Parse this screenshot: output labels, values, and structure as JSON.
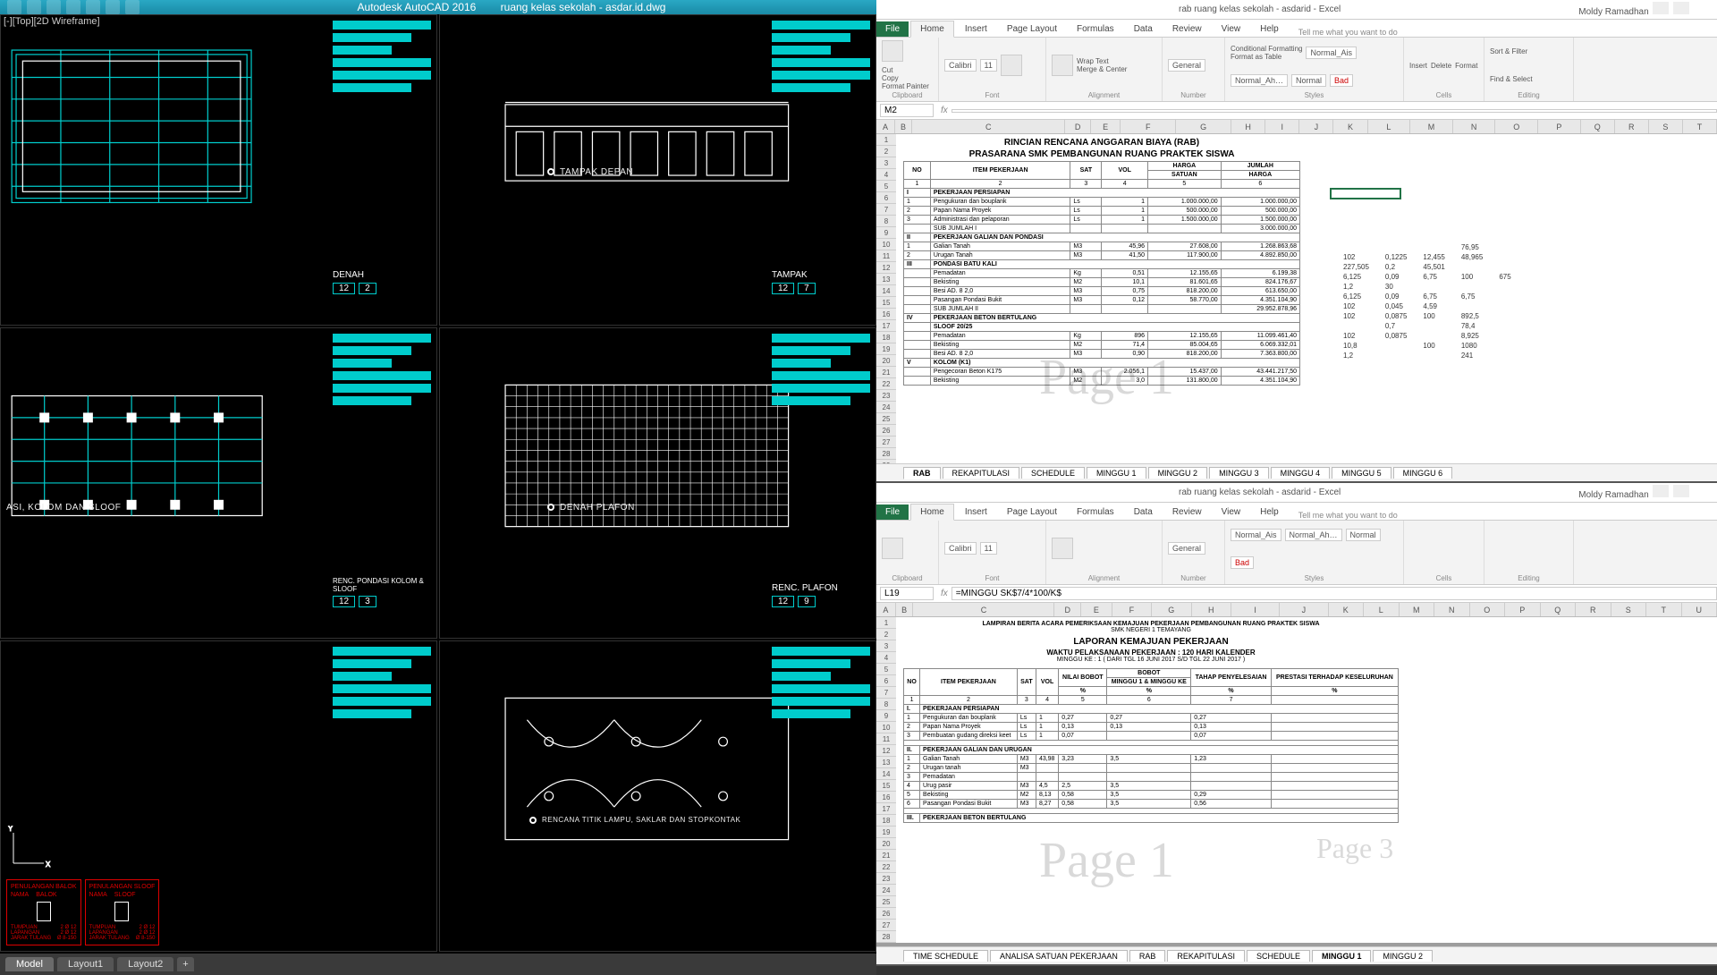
{
  "autocad": {
    "app_title": "Autodesk AutoCAD 2016",
    "file_name": "ruang kelas sekolah - asdar.id.dwg",
    "viewport_label": "[-][Top][2D Wireframe]",
    "panels": [
      {
        "title": "DENAH",
        "page_a": "12",
        "page_b": "2"
      },
      {
        "title": "TAMPAK",
        "label": "TAMPAK DEPAN",
        "page_a": "12",
        "page_b": "7"
      },
      {
        "title_top": "ASI, KOLOM DAN SLOOF",
        "title": "RENC. PONDASI KOLOM & SLOOF",
        "page_a": "12",
        "page_b": "3"
      },
      {
        "title": "RENC. PLAFON",
        "label": "DENAH PLAFON",
        "page_a": "12",
        "page_b": "9"
      },
      {
        "label": "RENCANA TITIK LAMPU, SAKLAR DAN STOPKONTAK"
      }
    ],
    "penulangan": {
      "h1": "PENULANGAN BALOK",
      "c1a": "NAMA",
      "c1b": "BALOK",
      "h2": "PENULANGAN SLOOF",
      "c2a": "NAMA",
      "c2b": "SLOOF"
    },
    "tabs": [
      "Model",
      "Layout1",
      "Layout2"
    ]
  },
  "excel1": {
    "window_title": "rab ruang kelas sekolah - asdarid - Excel",
    "user": "Moldy Ramadhan",
    "ribbon_tabs": [
      "File",
      "Home",
      "Insert",
      "Page Layout",
      "Formulas",
      "Data",
      "Review",
      "View",
      "Help"
    ],
    "tellme": "Tell me what you want to do",
    "clipboard": {
      "cut": "Cut",
      "copy": "Copy",
      "fp": "Format Painter",
      "name": "Clipboard"
    },
    "font": {
      "name": "Calibri",
      "size": "11",
      "group": "Font"
    },
    "alignment": {
      "wrap": "Wrap Text",
      "merge": "Merge & Center",
      "name": "Alignment"
    },
    "number": {
      "fmt": "General",
      "name": "Number"
    },
    "styles": {
      "cf": "Conditional Formatting",
      "ft": "Format as Table",
      "na": "Normal_Ais",
      "nah": "Normal_Ah…",
      "normal": "Normal",
      "bad": "Bad",
      "name": "Styles"
    },
    "cells": {
      "ins": "Insert",
      "del": "Delete",
      "fmt": "Format",
      "name": "Cells"
    },
    "editing": {
      "sf": "Sort & Filter",
      "fs": "Find & Select",
      "name": "Editing"
    },
    "namebox": "M2",
    "formula": "",
    "cols": [
      "A",
      "B",
      "C",
      "D",
      "E",
      "F",
      "G",
      "H",
      "I",
      "J",
      "K",
      "L",
      "M",
      "N",
      "O",
      "P",
      "Q",
      "R",
      "S",
      "T"
    ],
    "doc": {
      "t1": "RINCIAN RENCANA ANGGARAN BIAYA (RAB)",
      "t2": "PRASARANA SMK PEMBANGUNAN RUANG PRAKTEK SISWA",
      "h_no": "NO",
      "h_item": "ITEM PEKERJAAN",
      "h_sat": "SAT",
      "h_vol": "VOL",
      "h_harga": "HARGA",
      "h_satuan": "SATUAN",
      "h_jumlah": "JUMLAH",
      "h_jharga": "HARGA",
      "s1": "I",
      "s1t": "PEKERJAAN PERSIAPAN",
      "s2": "II",
      "s2t": "PEKERJAAN GALIAN DAN PONDASI",
      "s3": "III",
      "s3t": "PONDASI BATU KALI",
      "s4": "IV",
      "s4t": "PEKERJAAN BETON BERTULANG",
      "s5": "",
      "s5t": "SLOOF 20/25",
      "s6": "V",
      "s6t": "KOLOM (K1)",
      "rows": [
        {
          "n": "1",
          "item": "Pengukuran dan bouplank",
          "sat": "Ls",
          "vol": "1",
          "hs": "1.000.000,00",
          "jh": "1.000.000,00"
        },
        {
          "n": "2",
          "item": "Papan Nama Proyek",
          "sat": "Ls",
          "vol": "1",
          "hs": "500.000,00",
          "jh": "500.000,00"
        },
        {
          "n": "3",
          "item": "Administrasi dan pelaporan",
          "sat": "Ls",
          "vol": "1",
          "hs": "1.500.000,00",
          "jh": "1.500.000,00"
        },
        {
          "n": "",
          "item": "SUB JUMLAH I",
          "sat": "",
          "vol": "",
          "hs": "",
          "jh": "3.000.000,00"
        },
        {
          "n": "1",
          "item": "Galian Tanah",
          "sat": "M3",
          "vol": "45,96",
          "hs": "27.608,00",
          "jh": "1.268.863,68"
        },
        {
          "n": "2",
          "item": "Urugan Tanah",
          "sat": "M3",
          "vol": "41,50",
          "hs": "117.900,00",
          "jh": "4.892.850,00"
        },
        {
          "n": "",
          "item": "Pemadatan",
          "sat": "Kg",
          "vol": "0,51",
          "hs": "12.155,65",
          "jh": "6.199,38"
        },
        {
          "n": "",
          "item": "Bekisting",
          "sat": "M2",
          "vol": "10,1",
          "hs": "81.601,65",
          "jh": "824.176,67"
        },
        {
          "n": "",
          "item": "Besi AD. 8 2,0",
          "sat": "M3",
          "vol": "0,75",
          "hs": "818.200,00",
          "jh": "613.650,00"
        },
        {
          "n": "",
          "item": "Pasangan Pondasi Bukit",
          "sat": "M3",
          "vol": "0,12",
          "hs": "58.770,00",
          "jh": "4.351.104,90"
        },
        {
          "n": "",
          "item": "SUB JUMLAH II",
          "sat": "",
          "vol": "",
          "hs": "",
          "jh": "29.952.878,96"
        },
        {
          "n": "",
          "item": "Pemadatan",
          "sat": "Kg",
          "vol": "896",
          "hs": "12.155,65",
          "jh": "11.099.461,40"
        },
        {
          "n": "",
          "item": "Bekisting",
          "sat": "M2",
          "vol": "71,4",
          "hs": "85.004,65",
          "jh": "6.069.332,01"
        },
        {
          "n": "",
          "item": "Besi AD. 8 2,0",
          "sat": "M3",
          "vol": "0,90",
          "hs": "818.200,00",
          "jh": "7.363.800,00"
        },
        {
          "n": "",
          "item": "Pengecoran Beton K175",
          "sat": "M3",
          "vol": "2.056,1",
          "hs": "15.437,00",
          "jh": "43.441.217,50"
        },
        {
          "n": "",
          "item": "Bekisting",
          "sat": "M2",
          "vol": "3,0",
          "hs": "131.800,00",
          "jh": "4.351.104,90"
        }
      ],
      "side": [
        [
          "",
          "",
          "",
          "76,95",
          ""
        ],
        [
          "102",
          "0,1225",
          "12,455",
          "48,965",
          ""
        ],
        [
          "227,505",
          "0,2",
          "45,501",
          "",
          ""
        ],
        [
          "6,125",
          "0,09",
          "6,75",
          "100",
          "675"
        ],
        [
          "1,2",
          "30",
          "",
          "",
          ""
        ],
        [
          "6,125",
          "0,09",
          "6,75",
          "6,75",
          ""
        ],
        [
          "102",
          "0,045",
          "4,59",
          "",
          ""
        ],
        [
          "102",
          "0,0875",
          "100",
          "892,5",
          ""
        ],
        [
          "",
          "0,7",
          "",
          "78,4",
          ""
        ],
        [
          "102",
          "0,0875",
          "",
          "8,925",
          ""
        ],
        [
          "10,8",
          "",
          "100",
          "1080",
          ""
        ],
        [
          "1,2",
          "",
          "",
          "241",
          ""
        ]
      ]
    },
    "watermark": "Page 1",
    "sheets": [
      "RAB",
      "REKAPITULASI",
      "SCHEDULE",
      "MINGGU 1",
      "MINGGU 2",
      "MINGGU 3",
      "MINGGU 4",
      "MINGGU 5",
      "MINGGU 6"
    ]
  },
  "excel2": {
    "window_title": "rab ruang kelas sekolah - asdarid - Excel",
    "user": "Moldy Ramadhan",
    "namebox": "L19",
    "formula": "=MINGGU SK$7/4*100/K$",
    "cols": [
      "A",
      "B",
      "C",
      "D",
      "E",
      "F",
      "G",
      "H",
      "I",
      "J",
      "K",
      "L",
      "M",
      "N",
      "O",
      "P",
      "Q",
      "R",
      "S",
      "T",
      "U"
    ],
    "doc": {
      "t1": "LAMPIRAN BERITA ACARA PEMERIKSAAN KEMAJUAN PEKERJAAN PEMBANGUNAN RUANG PRAKTEK SISWA",
      "t2": "SMK NEGERI 1 TEMAYANG",
      "t3": "LAPORAN KEMAJUAN PEKERJAAN",
      "t4": "WAKTU PELAKSANAAN PEKERJAAN : 120 HARI KALENDER",
      "t5": "MINGGU KE : 1   ( DARI TGL 16 JUNI 2017 S/D TGL  22 JUNI 2017 )",
      "h_no": "NO",
      "h_item": "ITEM PEKERJAAN",
      "h_sat": "SAT",
      "h_vol": "VOL",
      "h_nilai": "NILAI BOBOT",
      "h_bobot": "BOBOT",
      "h_tahap": "TAHAP PENYELESAIAN",
      "h_prestasi": "PRESTASI TERHADAP KESELURUHAN",
      "h_sub": "MINGGU 1 & MINGGU KE",
      "h_pct": "%",
      "nums": [
        "1",
        "2",
        "3",
        "4",
        "5",
        "6",
        "7"
      ],
      "s1": "I.",
      "s1t": "PEKERJAAN PERSIAPAN",
      "r1": [
        {
          "n": "1",
          "item": "Pengukuran dan bouplank",
          "sat": "Ls",
          "vol": "1",
          "nb": "0,27",
          "b": "0,27",
          "t": "0,27"
        },
        {
          "n": "2",
          "item": "Papan Nama Proyek",
          "sat": "Ls",
          "vol": "1",
          "nb": "0,13",
          "b": "0,13",
          "t": "0,13"
        },
        {
          "n": "3",
          "item": "Pembuatan gudang direksi keet",
          "sat": "Ls",
          "vol": "1",
          "nb": "0,07",
          "b": "",
          "t": "0,07"
        }
      ],
      "s2": "II.",
      "s2t": "PEKERJAAN GALIAN DAN URUGAN",
      "r2": [
        {
          "n": "1",
          "item": "Galian Tanah",
          "sat": "M3",
          "vol": "43,98",
          "nb": "3,23",
          "b": "3,5",
          "t": "1,23"
        },
        {
          "n": "2",
          "item": "Urugan tanah",
          "sat": "M3",
          "vol": "",
          "nb": "",
          "b": "",
          "t": ""
        },
        {
          "n": "3",
          "item": "Pemadatan",
          "sat": "",
          "vol": "",
          "nb": "",
          "b": "",
          "t": ""
        },
        {
          "n": "4",
          "item": "Urug pasir",
          "sat": "M3",
          "vol": "4,5",
          "nb": "2,5",
          "b": "3,5",
          "t": ""
        },
        {
          "n": "5",
          "item": "Bekisting",
          "sat": "M2",
          "vol": "8,13",
          "nb": "0,58",
          "b": "3,5",
          "t": "0,29"
        },
        {
          "n": "6",
          "item": "Pasangan Pondasi Bukit",
          "sat": "M3",
          "vol": "8,27",
          "nb": "0,58",
          "b": "3,5",
          "t": "0,56"
        }
      ],
      "s3": "III.",
      "s3t": "PEKERJAAN BETON BERTULANG"
    },
    "watermark1": "Page 1",
    "watermark2": "Page 3",
    "sheets": [
      "TIME SCHEDULE",
      "ANALISA SATUAN PEKERJAAN",
      "RAB",
      "REKAPITULASI",
      "SCHEDULE",
      "MINGGU 1",
      "MINGGU 2"
    ]
  }
}
